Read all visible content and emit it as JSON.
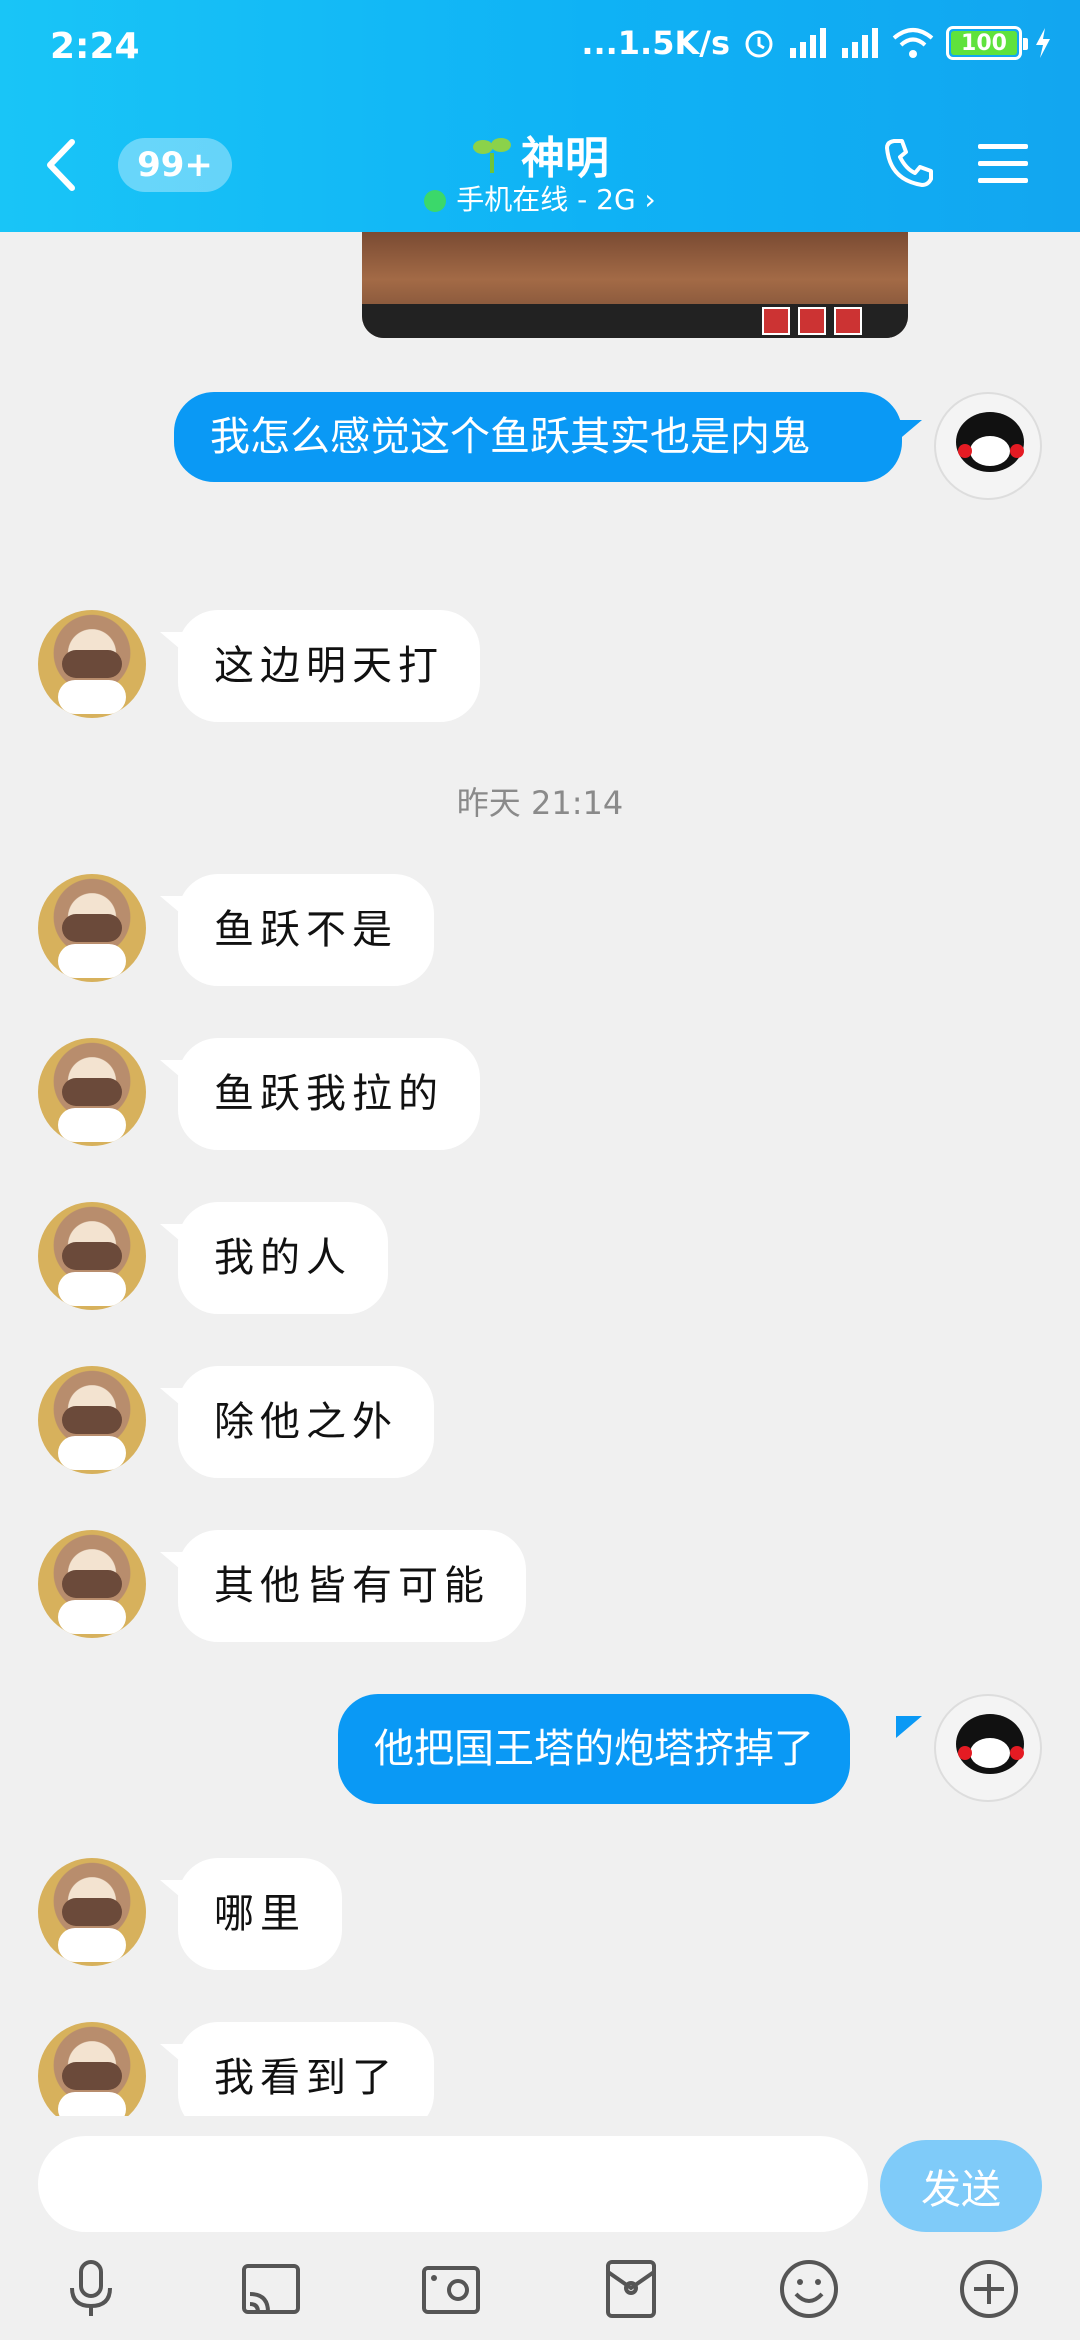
{
  "status": {
    "time": "2:24",
    "net_speed": "...1.5K/s",
    "battery": "100"
  },
  "header": {
    "unread_badge": "99+",
    "contact_name": "神明",
    "online_status": "手机在线 - 2G"
  },
  "messages": {
    "m1": "我怎么感觉这个鱼跃其实也是内鬼",
    "m2": "这边明天打",
    "timestamp": "昨天 21:14",
    "m3": "鱼跃不是",
    "m4": "鱼跃我拉的",
    "m5": "我的人",
    "m6": "除他之外",
    "m7": "其他皆有可能",
    "m8": "他把国王塔的炮塔挤掉了",
    "m9": "哪里",
    "m10": "我看到了"
  },
  "input": {
    "placeholder": "",
    "send_label": "发送"
  },
  "toolbar_icons": [
    "microphone-icon",
    "cast-icon",
    "photo-icon",
    "red-packet-icon",
    "emoji-icon",
    "plus-icon"
  ]
}
